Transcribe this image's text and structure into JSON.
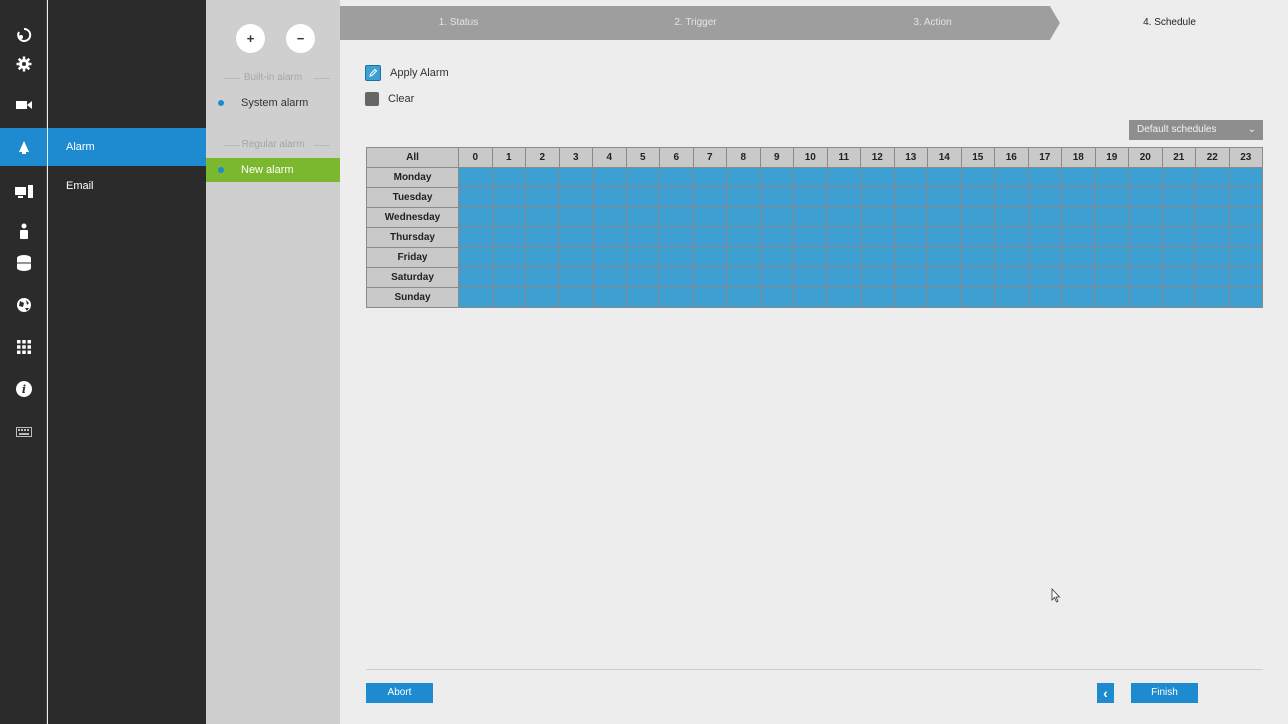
{
  "rail": {
    "items": [
      {
        "icon": "logout-icon"
      },
      {
        "icon": "gear-icon"
      },
      {
        "icon": "camera-icon"
      },
      {
        "icon": "bell-icon"
      },
      {
        "icon": "computer-icon"
      },
      {
        "icon": "user-icon"
      },
      {
        "icon": "storage-icon"
      },
      {
        "icon": "network-globe-icon"
      },
      {
        "icon": "apps-grid-icon"
      },
      {
        "icon": "info-icon"
      },
      {
        "icon": "keyboard-icon"
      }
    ],
    "active_index": 3
  },
  "submenu": {
    "items": [
      "Alarm",
      "Email"
    ],
    "active": "Alarm"
  },
  "alarm_list": {
    "add_symbol": "+",
    "remove_symbol": "−",
    "builtin_title": "Built-in alarm",
    "regular_title": "Regular alarm",
    "builtin_items": [
      "System alarm"
    ],
    "regular_items": [
      "New alarm"
    ]
  },
  "wizard": {
    "steps": [
      "1. Status",
      "2. Trigger",
      "3. Action",
      "4. Schedule"
    ],
    "active_step": 3
  },
  "legend": {
    "apply": "Apply Alarm",
    "clear": "Clear"
  },
  "schedule_select": {
    "value": "Default schedules"
  },
  "schedule": {
    "all_label": "All",
    "hours": [
      "0",
      "1",
      "2",
      "3",
      "4",
      "5",
      "6",
      "7",
      "8",
      "9",
      "10",
      "11",
      "12",
      "13",
      "14",
      "15",
      "16",
      "17",
      "18",
      "19",
      "20",
      "21",
      "22",
      "23"
    ],
    "days": [
      "Monday",
      "Tuesday",
      "Wednesday",
      "Thursday",
      "Friday",
      "Saturday",
      "Sunday"
    ],
    "fill": "all-applied"
  },
  "buttons": {
    "abort": "Abort",
    "back_symbol": "‹",
    "finish": "Finish"
  },
  "colors": {
    "accent": "#1e8bd0",
    "cell_applied": "#3d9fd2",
    "active_alarm": "#7cb82f",
    "step_bar": "#9e9e9e"
  }
}
